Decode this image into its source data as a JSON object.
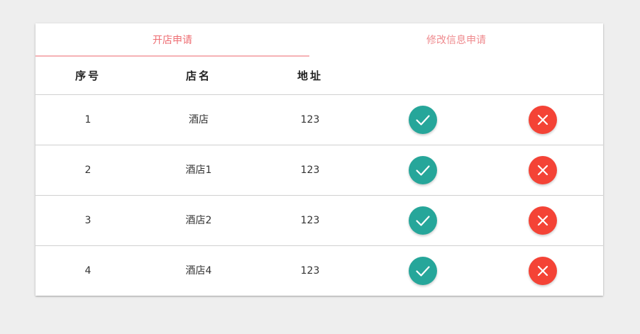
{
  "tabs": [
    {
      "label": "开店申请",
      "active": true
    },
    {
      "label": "修改信息申请",
      "active": false
    }
  ],
  "table": {
    "headers": [
      "序号",
      "店名",
      "地址"
    ],
    "rows": [
      {
        "index": "1",
        "name": "酒店",
        "address": "123"
      },
      {
        "index": "2",
        "name": "酒店1",
        "address": "123"
      },
      {
        "index": "3",
        "name": "酒店2",
        "address": "123"
      },
      {
        "index": "4",
        "name": "酒店4",
        "address": "123"
      }
    ]
  },
  "actions": {
    "approve_icon": "check-icon",
    "reject_icon": "close-icon"
  },
  "colors": {
    "accent": "#ee6e73",
    "approve": "#26a69a",
    "reject": "#f44336",
    "background": "#eeeeee"
  }
}
